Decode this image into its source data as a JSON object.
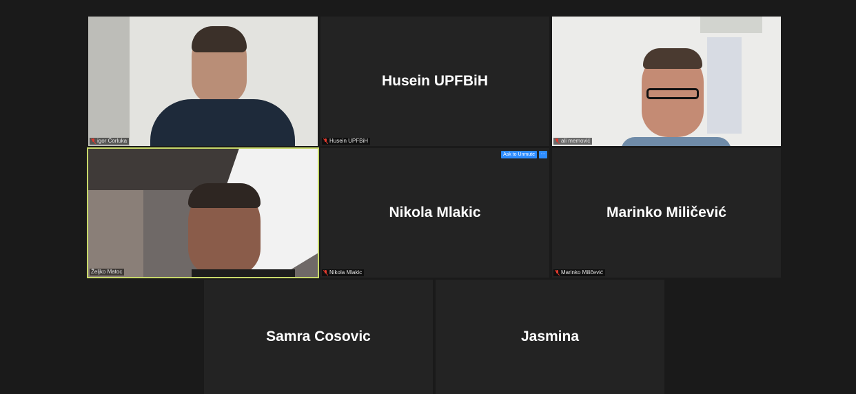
{
  "participants": [
    {
      "name": "igor Ćorluka",
      "video": true,
      "muted": true
    },
    {
      "name": "Husein UPFBiH",
      "display_name": "Husein UPFBiH",
      "video": false,
      "muted": true
    },
    {
      "name": "ali memović",
      "video": true,
      "muted": true
    },
    {
      "name": "Željko Matoc",
      "video": true,
      "muted": false,
      "active_speaker": true
    },
    {
      "name": "Nikola Mlakic",
      "display_name": "Nikola Mlakic",
      "video": false,
      "muted": true,
      "hover_controls": {
        "ask_to_unmute": "Ask to Unmute",
        "more": "···"
      }
    },
    {
      "name": "Marinko Miličević",
      "display_name": "Marinko Miličević",
      "video": false,
      "muted": true
    },
    {
      "display_name": "Samra Cosovic",
      "video": false
    },
    {
      "display_name": "Jasmina",
      "video": false
    }
  ],
  "colors": {
    "background": "#1a1a1a",
    "tile": "#232323",
    "active_border": "#c8d96a",
    "accent": "#2d8cff",
    "muted_mic": "#e23a2e"
  }
}
